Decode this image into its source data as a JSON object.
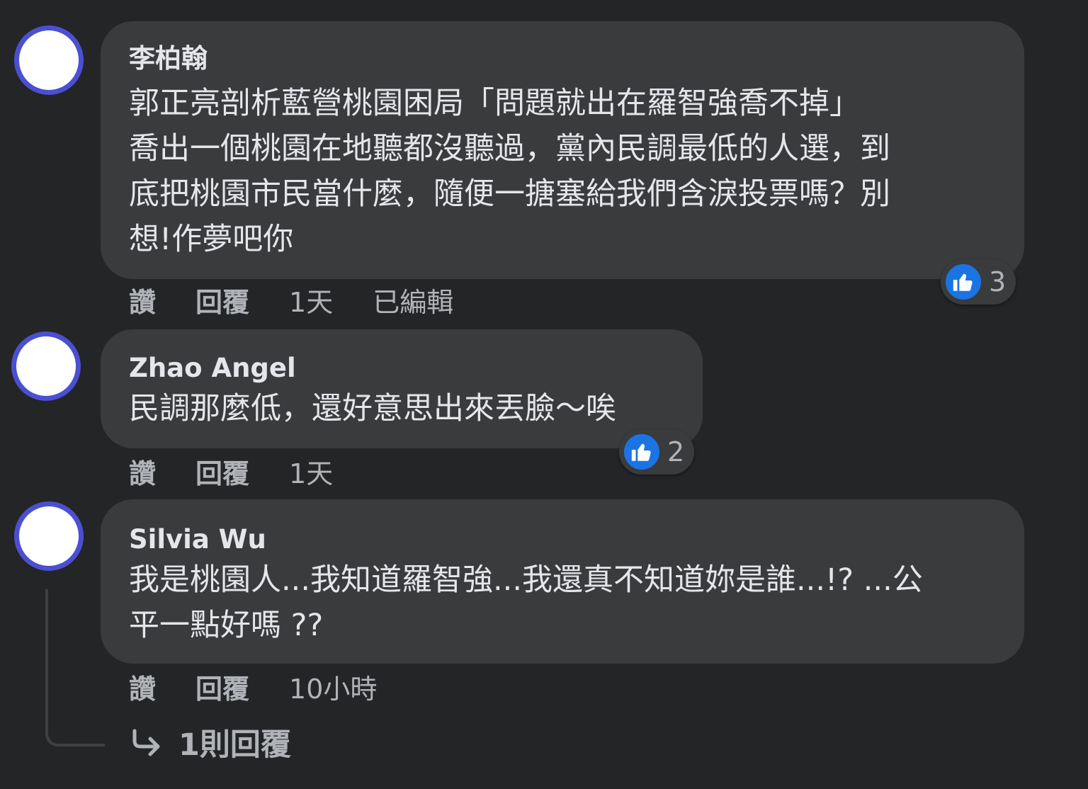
{
  "comments": [
    {
      "author": "李柏翰",
      "text_lines": [
        "郭正亮剖析藍營桃園困局「問題就出在羅智強喬不掉」",
        "喬出一個桃園在地聽都沒聽過，黨內民調最低的人選，到",
        "底把桃園市民當什麼，隨便一搪塞給我們含淚投票嗎？別",
        "想!作夢吧你"
      ],
      "like_label": "讚",
      "reply_label": "回覆",
      "time": "1天",
      "edited_label": "已編輯",
      "reaction_count": "3",
      "reaction_icon": "like-icon"
    },
    {
      "author": "Zhao Angel",
      "text_lines": [
        "民調那麼低，還好意思出來丟臉～唉"
      ],
      "like_label": "讚",
      "reply_label": "回覆",
      "time": "1天",
      "reaction_count": "2",
      "reaction_icon": "like-icon"
    },
    {
      "author": "Silvia Wu",
      "text_lines": [
        "我是桃園人...我知道羅智強...我還真不知道妳是誰...!? ...公",
        "平一點好嗎 ??"
      ],
      "like_label": "讚",
      "reply_label": "回覆",
      "time": "10小時"
    }
  ],
  "replies_link": {
    "label": "1則回覆",
    "icon": "reply-arrow-icon"
  },
  "colors": {
    "background": "#242526",
    "bubble": "#3a3b3c",
    "text_primary": "#e4e6eb",
    "text_secondary": "#b0b3b8",
    "avatar_ring": "#4b4fd1",
    "like_blue": "#1b74e4"
  }
}
